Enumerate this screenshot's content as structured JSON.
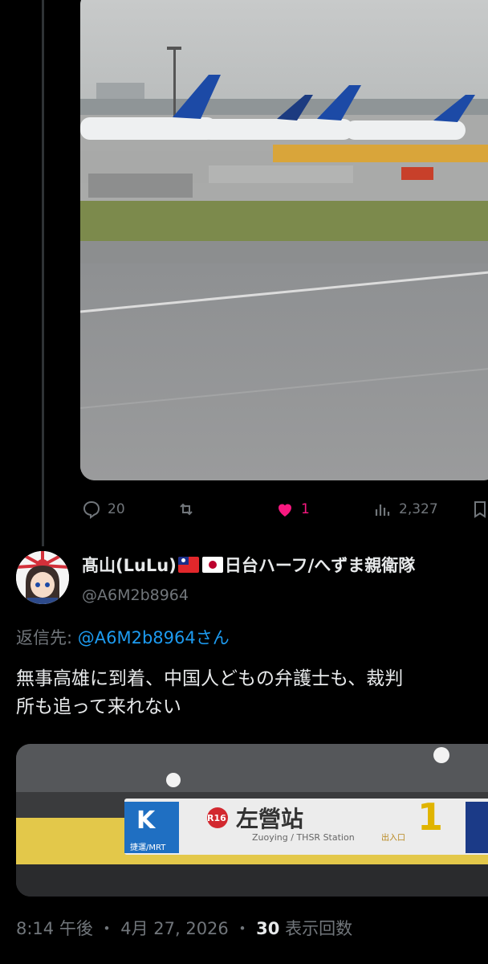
{
  "tweet1": {
    "actions": {
      "replies": "20",
      "retweets": "",
      "likes": "1",
      "views": "2,327"
    }
  },
  "tweet2": {
    "display_name": "髙山(LuLu)",
    "display_name_suffix": "日台ハーフ/へずま親衛隊",
    "handle": "@A6M2b8964",
    "reply_label": "返信先: ",
    "reply_mention": "@A6M2b8964さん",
    "text": "無事高雄に到着、中国人どもの弁護士も、裁判\n所も追って来れない",
    "image_sign": {
      "metro_line": "R16",
      "station_name": "左營站",
      "station_sub": "Zuoying / THSR Station",
      "mrt_label": "捷運/MRT",
      "exit_label": "出入口",
      "exit_number": "1"
    },
    "meta": {
      "time": "8:14 午後",
      "date": "4月 27, 2026",
      "views_count": "30",
      "views_label": "表示回数",
      "separator": "・"
    }
  },
  "colors": {
    "background": "#000000",
    "text": "#e7e9ea",
    "muted": "#71767b",
    "link": "#1d9bf0",
    "like": "#f91880"
  }
}
